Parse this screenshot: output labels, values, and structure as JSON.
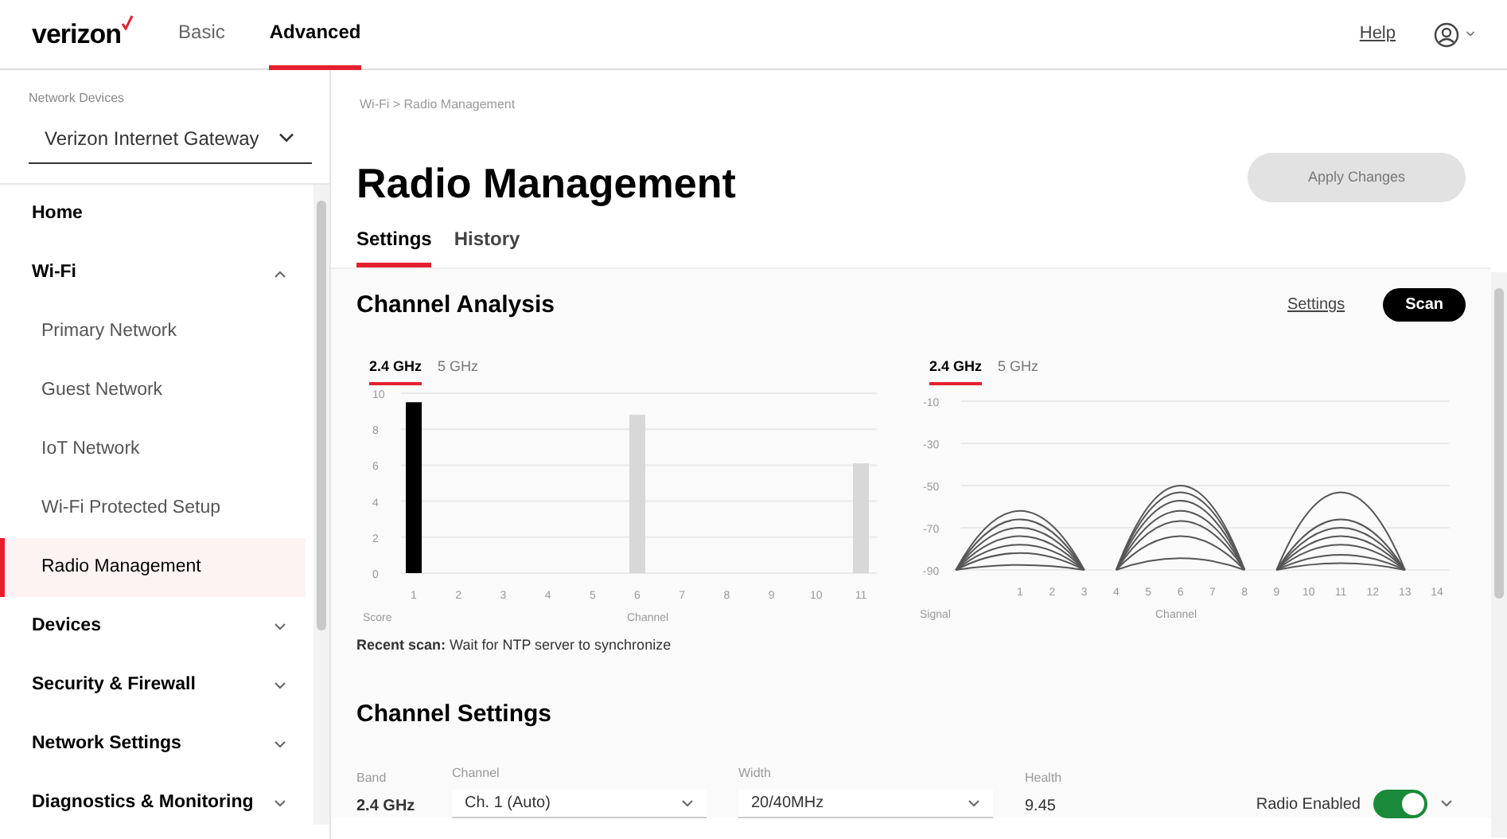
{
  "header": {
    "logo": "verizon",
    "tabs": [
      {
        "label": "Basic",
        "selected": false
      },
      {
        "label": "Advanced",
        "selected": true
      }
    ],
    "help_link": "Help"
  },
  "sidebar": {
    "device_label": "Network Devices",
    "device": "Verizon Internet Gateway",
    "items": [
      {
        "label": "Home",
        "selected": false
      },
      {
        "label": "Wi-Fi",
        "selected": false,
        "expanded": true,
        "children": [
          {
            "label": "Primary Network",
            "selected": false
          },
          {
            "label": "Guest Network",
            "selected": false
          },
          {
            "label": "IoT Network",
            "selected": false
          },
          {
            "label": "Wi-Fi Protected Setup",
            "selected": false
          },
          {
            "label": "Radio Management",
            "selected": true
          }
        ]
      },
      {
        "label": "Devices",
        "selected": false,
        "expanded": false
      },
      {
        "label": "Security & Firewall",
        "selected": false,
        "expanded": false
      },
      {
        "label": "Network Settings",
        "selected": false,
        "expanded": false
      },
      {
        "label": "Diagnostics & Monitoring",
        "selected": false,
        "expanded": false
      }
    ]
  },
  "breadcrumb": {
    "items": [
      "Wi-Fi",
      "Radio Management"
    ],
    "separator": ">"
  },
  "page_title": "Radio Management",
  "apply_button": {
    "label": "Apply Changes",
    "disabled": true
  },
  "tabs": [
    {
      "label": "Settings",
      "selected": true
    },
    {
      "label": "History",
      "selected": false
    }
  ],
  "channel_analysis": {
    "title": "Channel Analysis",
    "settings_link": "Settings",
    "scan_button": "Scan",
    "charts": [
      {
        "kind": "bar",
        "bands": [
          {
            "label": "2.4 GHz",
            "selected": true
          },
          {
            "label": "5 GHz",
            "selected": false
          }
        ],
        "chart_data": {
          "type": "bar",
          "xlabel": "Channel",
          "ylabel": "Score",
          "categories": [
            "1",
            "2",
            "3",
            "4",
            "5",
            "6",
            "7",
            "8",
            "9",
            "10",
            "11"
          ],
          "ylim": [
            0,
            10
          ],
          "yticks": [
            0,
            2,
            4,
            6,
            8,
            10
          ],
          "grid": true,
          "series": [
            {
              "color": "#000000",
              "values": [
                9.5,
                null,
                null,
                null,
                null,
                null,
                null,
                null,
                null,
                null,
                null
              ]
            },
            {
              "color": "#d8d8d8",
              "values": [
                null,
                null,
                null,
                null,
                null,
                8.8,
                null,
                null,
                null,
                null,
                6.1
              ]
            }
          ]
        }
      },
      {
        "kind": "signal",
        "bands": [
          {
            "label": "2.4 GHz",
            "selected": true
          },
          {
            "label": "5 GHz",
            "selected": false
          }
        ],
        "xlabel": "Channel",
        "ylabel": "Signal",
        "x_tick_labels": [
          "1",
          "2",
          "3",
          "4",
          "5",
          "6",
          "7",
          "8",
          "9",
          "10",
          "11",
          "12",
          "13",
          "14"
        ],
        "y_tick_labels": [
          "-10",
          "-30",
          "-50",
          "-70",
          "-90"
        ]
      }
    ],
    "recent_scan": "**Recent scan:** Wait for NTP server to synchronize"
  },
  "channel_settings": {
    "title": "Channel Settings",
    "fields": [
      {
        "kind": "text",
        "label": "Band",
        "value": "2.4 GHz"
      },
      {
        "kind": "select",
        "label": "Channel",
        "value": "Ch. 1 (Auto)"
      },
      {
        "kind": "select",
        "label": "Width",
        "value": "20/40MHz"
      },
      {
        "kind": "text",
        "label": "Health",
        "value": "9.45"
      },
      {
        "kind": "toggle",
        "label": "Radio Enabled",
        "on": true
      }
    ]
  }
}
